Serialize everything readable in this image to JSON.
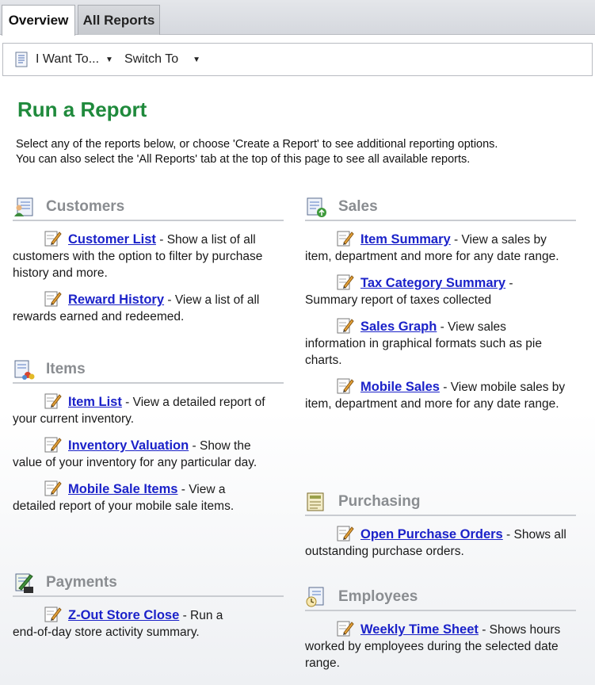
{
  "tabs": [
    {
      "label": "Overview",
      "active": true
    },
    {
      "label": "All Reports",
      "active": false
    }
  ],
  "toolbar": {
    "i_want_to": "I Want To...",
    "switch_to": "Switch To"
  },
  "page": {
    "title": "Run a Report",
    "intro_line1": "Select any of the reports below, or choose 'Create a Report' to see additional reporting options.",
    "intro_line2": "You can also select the 'All Reports' tab at the top of this page to see all available reports."
  },
  "sections": {
    "customers": {
      "title": "Customers",
      "icon": "customers-icon",
      "items": [
        {
          "link": "Customer List",
          "desc1": " - Show a list of all",
          "desc2": "customers with the option to filter by purchase history and more."
        },
        {
          "link": "Reward History",
          "desc1": " - View a list of all",
          "desc2": "rewards earned and redeemed."
        }
      ]
    },
    "items": {
      "title": "Items",
      "icon": "items-icon",
      "items": [
        {
          "link": "Item List",
          "desc1": " - View a detailed report of",
          "desc2": "your current inventory."
        },
        {
          "link": "Inventory Valuation",
          "desc1": " - Show the",
          "desc2": "value of your inventory for any particular day."
        },
        {
          "link": "Mobile Sale Items",
          "desc1": " - View a",
          "desc2": "detailed report of your mobile sale items."
        }
      ]
    },
    "payments": {
      "title": "Payments",
      "icon": "payments-icon",
      "items": [
        {
          "link": "Z-Out Store Close",
          "desc1": " - Run a",
          "desc2": "end-of-day store activity summary."
        }
      ]
    },
    "sales": {
      "title": "Sales",
      "icon": "sales-icon",
      "items": [
        {
          "link": "Item Summary",
          "desc1": " - View a sales by",
          "desc2": "item, department and more for any date range."
        },
        {
          "link": "Tax Category Summary",
          "desc1": " -",
          "desc2": "Summary report of taxes collected"
        },
        {
          "link": "Sales Graph",
          "desc1": " - View sales",
          "desc2": "information in graphical formats such as pie charts."
        },
        {
          "link": "Mobile Sales",
          "desc1": " - View mobile sales by",
          "desc2": "item, department and more for any date range."
        }
      ]
    },
    "purchasing": {
      "title": "Purchasing",
      "icon": "purchasing-icon",
      "items": [
        {
          "link": "Open Purchase Orders",
          "desc1": " - Shows all",
          "desc2": "outstanding purchase orders."
        }
      ]
    },
    "employees": {
      "title": "Employees",
      "icon": "employees-icon",
      "items": [
        {
          "link": "Weekly Time Sheet",
          "desc1": " - Shows hours",
          "desc2": "worked by employees during the selected date range."
        }
      ]
    }
  },
  "colors": {
    "title_green": "#1f8a3c",
    "link_blue": "#1b22c9",
    "section_gray": "#8a8d91"
  }
}
